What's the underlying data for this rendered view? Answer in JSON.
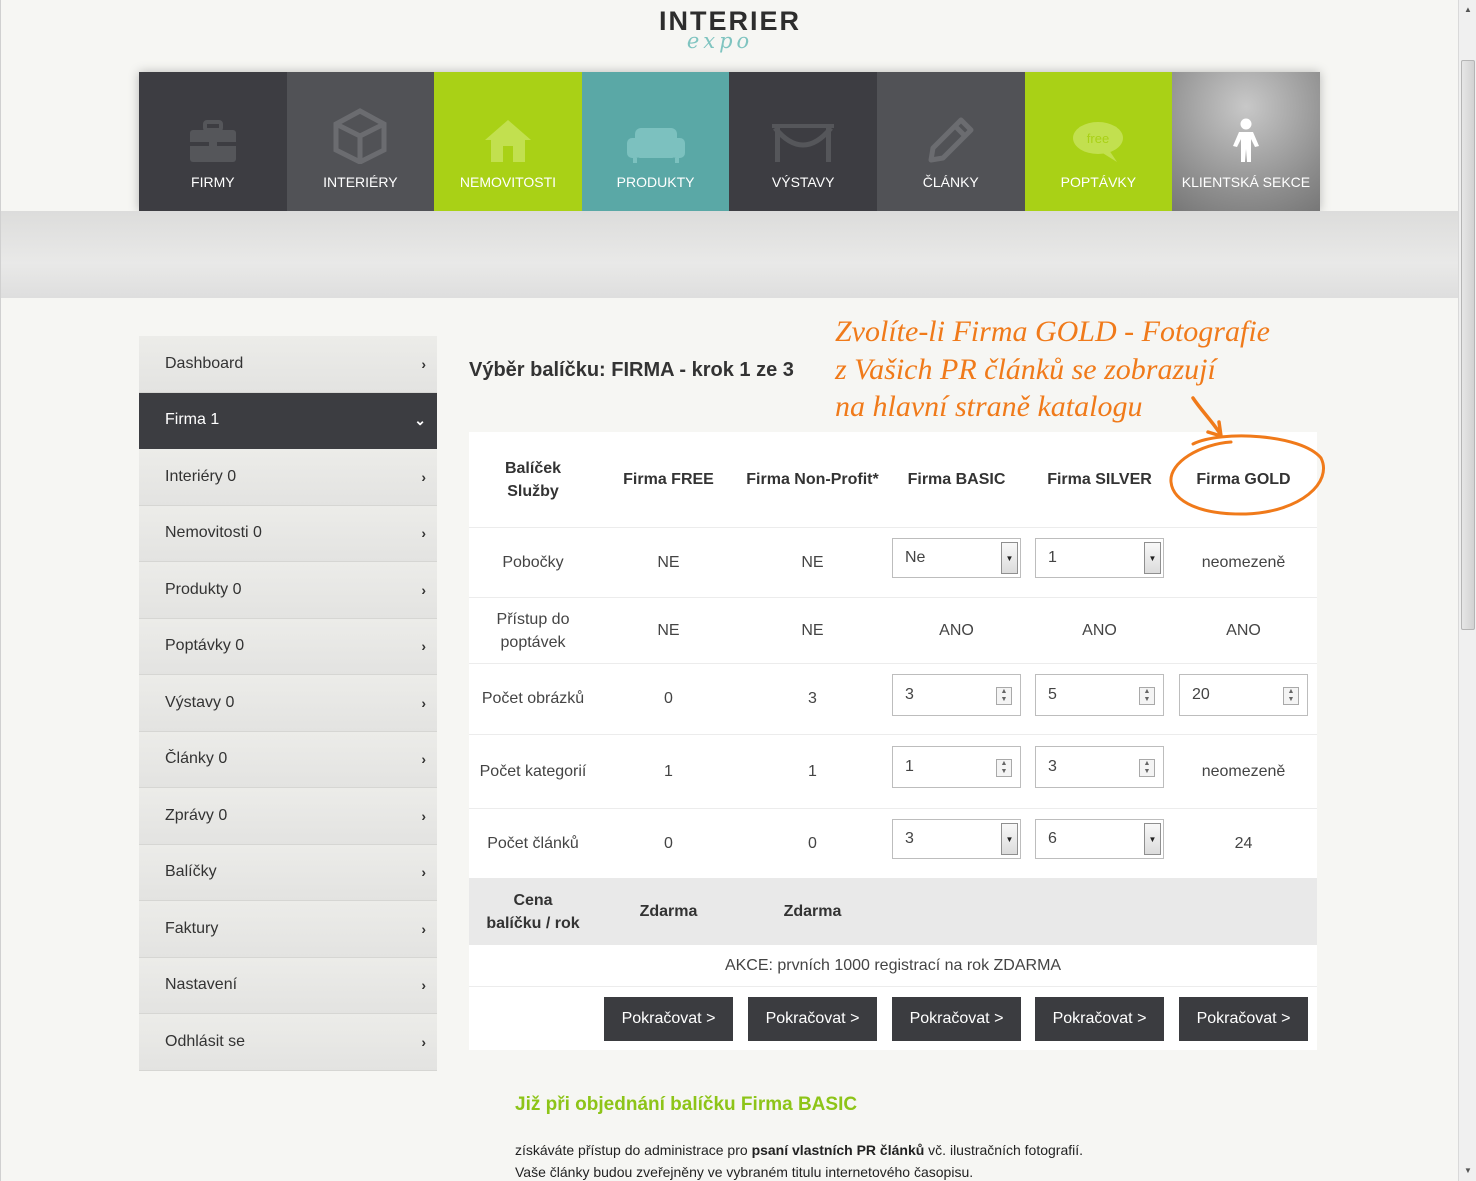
{
  "logo": {
    "main": "INTERIER",
    "sub": "expo"
  },
  "nav": [
    {
      "label": "FIRMY",
      "icon": "briefcase-icon",
      "color": "#3d3d42"
    },
    {
      "label": "INTERIÉRY",
      "icon": "cube-icon",
      "color": "#515256"
    },
    {
      "label": "NEMOVITOSTI",
      "icon": "house-icon",
      "color": "#a9d116"
    },
    {
      "label": "PRODUKTY",
      "icon": "sofa-icon",
      "color": "#5aa8a6"
    },
    {
      "label": "VÝSTAVY",
      "icon": "exhibition-icon",
      "color": "#3d3d42"
    },
    {
      "label": "ČLÁNKY",
      "icon": "pencil-icon",
      "color": "#515256"
    },
    {
      "label": "POPTÁVKY",
      "icon": "free-bubble-icon",
      "icon_text": "free",
      "color": "#a9d116"
    },
    {
      "label": "KLIENTSKÁ SEKCE",
      "icon": "person-icon",
      "color": "#9a9a9a"
    }
  ],
  "sidebar": {
    "items": [
      {
        "label": "Dashboard",
        "chevron": "›"
      },
      {
        "label": "Firma 1",
        "chevron": "⌄",
        "active": true
      },
      {
        "label": "Interiéry 0",
        "chevron": "›"
      },
      {
        "label": "Nemovitosti 0",
        "chevron": "›"
      },
      {
        "label": "Produkty 0",
        "chevron": "›"
      },
      {
        "label": "Poptávky 0",
        "chevron": "›"
      },
      {
        "label": "Výstavy 0",
        "chevron": "›"
      },
      {
        "label": "Články 0",
        "chevron": "›"
      },
      {
        "label": "Zprávy 0",
        "chevron": "›"
      },
      {
        "label": "Balíčky",
        "chevron": "›"
      },
      {
        "label": "Faktury",
        "chevron": "›"
      },
      {
        "label": "Nastavení",
        "chevron": "›"
      },
      {
        "label": "Odhlásit se",
        "chevron": "›"
      }
    ]
  },
  "main": {
    "heading": "Výběr balíčku: FIRMA - krok 1 ze 3",
    "annotation": [
      "Zvolíte-li Firma GOLD - Fotografie",
      "z Vašich PR článků se zobrazují",
      "na hlavní straně katalogu"
    ],
    "annotation_color": "#f07a1a",
    "table": {
      "header": {
        "service": [
          "Balíček",
          "Služby"
        ],
        "packages": [
          "Firma FREE",
          "Firma Non-Profit*",
          "Firma BASIC",
          "Firma SILVER",
          "Firma GOLD"
        ]
      },
      "rows": {
        "pobocky": {
          "label": "Pobočky",
          "free": "NE",
          "nonprofit": "NE",
          "basic": "Ne",
          "silver": "1",
          "gold": "neomezeně"
        },
        "pristup": {
          "label": [
            "Přístup do",
            "poptávek"
          ],
          "free": "NE",
          "nonprofit": "NE",
          "basic": "ANO",
          "silver": "ANO",
          "gold": "ANO"
        },
        "obrazky": {
          "label": "Počet obrázků",
          "free": "0",
          "nonprofit": "3",
          "basic": "3",
          "silver": "5",
          "gold": "20"
        },
        "kategorie": {
          "label": "Počet kategorií",
          "free": "1",
          "nonprofit": "1",
          "basic": "1",
          "silver": "3",
          "gold": "neomezeně"
        },
        "clanky": {
          "label": "Počet článků",
          "free": "0",
          "nonprofit": "0",
          "basic": "3",
          "silver": "6",
          "gold": "24"
        }
      },
      "price": {
        "label": [
          "Cena",
          "balíčku / rok"
        ],
        "free": "Zdarma",
        "nonprofit": "Zdarma"
      },
      "promo": "AKCE: prvních 1000 registrací na rok ZDARMA",
      "button_label": "Pokračovat >"
    }
  },
  "bottom": {
    "title": "Již při objednání balíčku Firma BASIC",
    "text1_pre": "získáváte přístup do administrace pro ",
    "text1_bold": "psaní vlastních PR článků",
    "text1_post": " vč. ilustračních fotografií.",
    "text2": "Vaše články budou zveřejněny ve vybraném titulu internetového časopisu."
  }
}
